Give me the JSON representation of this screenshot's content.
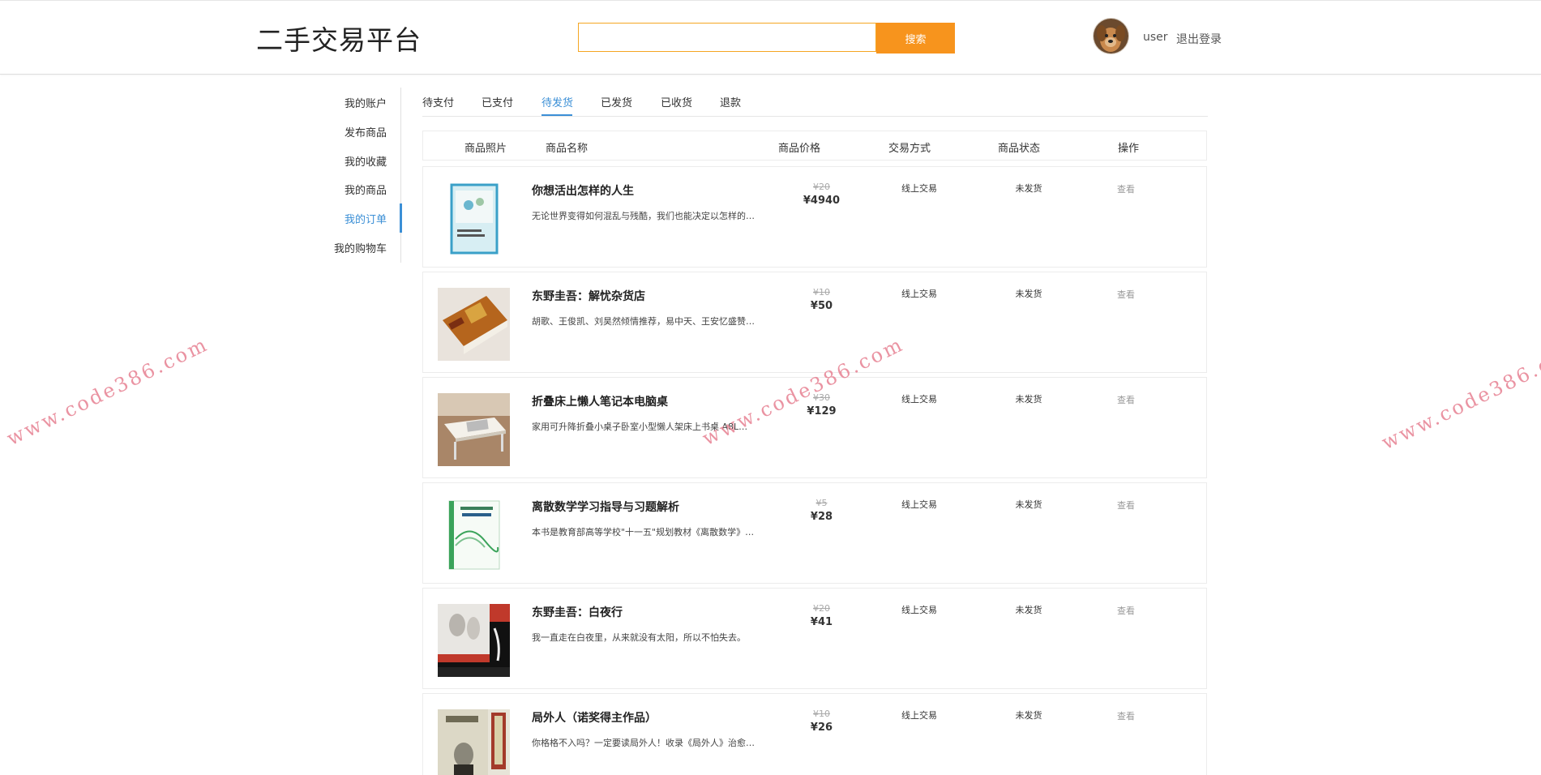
{
  "header": {
    "logo": "二手交易平台",
    "search": {
      "value": "",
      "button_label": "搜索"
    },
    "user": {
      "name": "user",
      "logout_label": "退出登录"
    }
  },
  "sidebar": {
    "items": [
      {
        "label": "我的账户"
      },
      {
        "label": "发布商品"
      },
      {
        "label": "我的收藏"
      },
      {
        "label": "我的商品"
      },
      {
        "label": "我的订单",
        "active": true
      },
      {
        "label": "我的购物车"
      }
    ]
  },
  "tabs": [
    {
      "label": "待支付"
    },
    {
      "label": "已支付"
    },
    {
      "label": "待发货",
      "active": true
    },
    {
      "label": "已发货"
    },
    {
      "label": "已收货"
    },
    {
      "label": "退款"
    }
  ],
  "table": {
    "headers": [
      "商品照片",
      "商品名称",
      "商品价格",
      "交易方式",
      "商品状态",
      "操作"
    ],
    "rows": [
      {
        "name": "你想活出怎样的人生",
        "desc": "无论世界变得如何混乱与残酷，我们也能决定以怎样的…",
        "orig_price": "¥20",
        "price": "¥4940",
        "trade": "线上交易",
        "status": "未发货",
        "action": "查看",
        "thumb_icon": "book-cover-blue"
      },
      {
        "name": "东野圭吾：解忧杂货店",
        "desc": "胡歌、王俊凯、刘昊然倾情推荐，易中天、王安忆盛赞…",
        "orig_price": "¥10",
        "price": "¥50",
        "trade": "线上交易",
        "status": "未发货",
        "action": "查看",
        "thumb_icon": "book-photo-orange"
      },
      {
        "name": "折叠床上懒人笔记本电脑桌",
        "desc": "家用可升降折叠小桌子卧室小型懒人架床上书桌 A8L…",
        "orig_price": "¥30",
        "price": "¥129",
        "trade": "线上交易",
        "status": "未发货",
        "action": "查看",
        "thumb_icon": "laptop-desk-photo"
      },
      {
        "name": "离散数学学习指导与习题解析",
        "desc": "本书是教育部高等学校\"十一五\"规划教材《离散数学》…",
        "orig_price": "¥5",
        "price": "¥28",
        "trade": "线上交易",
        "status": "未发货",
        "action": "查看",
        "thumb_icon": "book-cover-green"
      },
      {
        "name": "东野圭吾：白夜行",
        "desc": "我一直走在白夜里，从来就没有太阳，所以不怕失去。",
        "orig_price": "¥20",
        "price": "¥41",
        "trade": "线上交易",
        "status": "未发货",
        "action": "查看",
        "thumb_icon": "book-cover-red"
      },
      {
        "name": "局外人（诺奖得主作品）",
        "desc": "你格格不入吗？一定要读局外人！收录《局外人》治愈…",
        "orig_price": "¥10",
        "price": "¥26",
        "trade": "线上交易",
        "status": "未发货",
        "action": "查看",
        "thumb_icon": "book-cover-grey"
      }
    ]
  },
  "watermark": {
    "text": "www.code386.com"
  },
  "colors": {
    "accent": "#f7941d",
    "active": "#3b8fd6",
    "watermark": "#e88898"
  }
}
